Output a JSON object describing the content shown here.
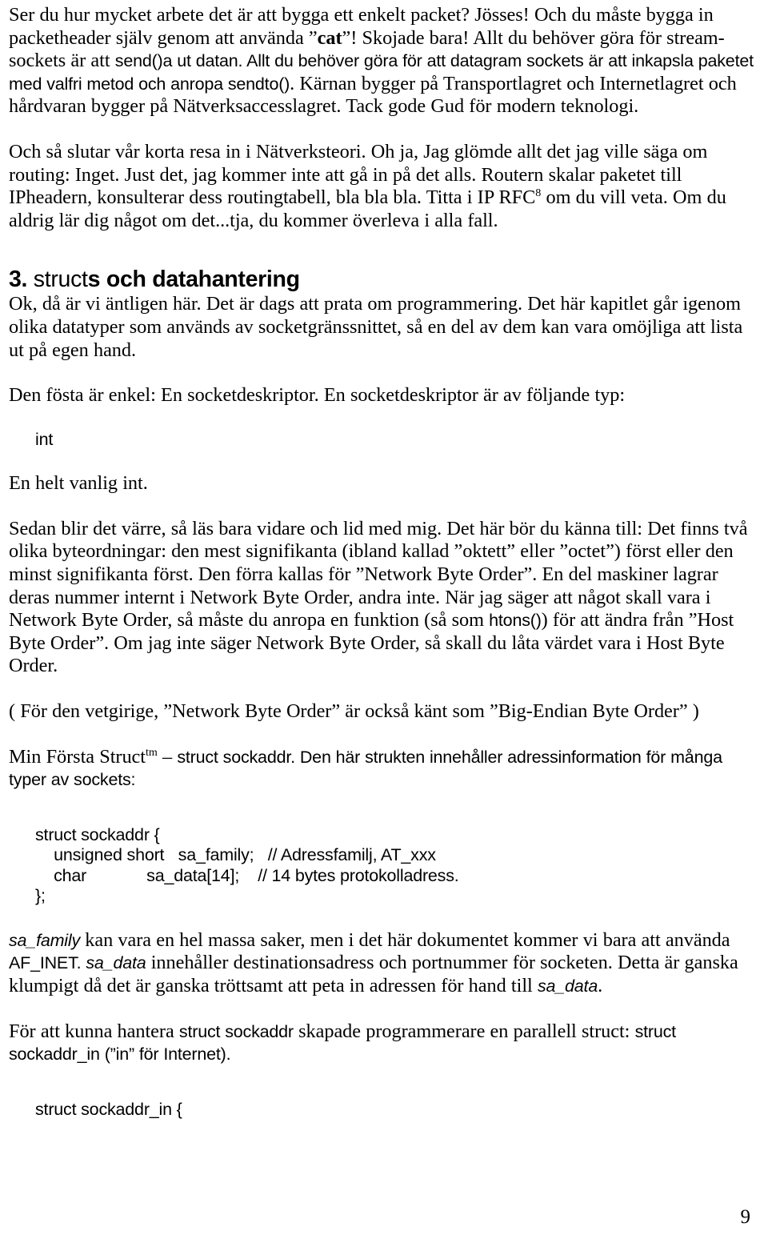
{
  "document": {
    "page_number": "9",
    "language": "sv",
    "paragraphs": {
      "intro_p1_a": "Ser du hur mycket arbete det är att bygga ett enkelt packet? Jösses! Och du måste bygga in packetheader själv genom att använda ”",
      "intro_p1_cat": "cat",
      "intro_p1_b": "”! Skojade bara! Allt du behöver göra för stream-sockets är att ",
      "intro_p1_send": "send()",
      "intro_p1_c": "a ut datan. Allt du behöver göra för att datagram sockets är att inkapsla paketet med valfri metod och anropa ",
      "intro_p1_sendto": "sendto()",
      "intro_p1_d": ". Kärnan bygger på Transportlagret och Internetlagret och hårdvaran bygger på Nätverksaccesslagret. Tack gode Gud för modern teknologi.",
      "intro_p2_a": "Och så slutar vår korta resa in i Nätverksteori. Oh ja, Jag glömde allt det jag ville säga om routing: Inget. Just det, jag kommer inte att gå in på det alls. Routern skalar paketet till IPheadern, konsulterar dess routingtabell, bla bla bla. Titta i IP RFC",
      "intro_p2_sup": "8",
      "intro_p2_b": " om du vill veta. Om du aldrig lär dig något om det...tja, du kommer överleva i alla fall.",
      "heading_num": "3.",
      "heading_code": " struct",
      "heading_rest": "s och datahantering",
      "sec_p1": "Ok, då är vi äntligen här. Det är dags att prata om programmering. Det här kapitlet går igenom olika datatyper som används av socketgränssnittet, så en del av dem kan vara omöjliga att lista ut på egen hand.",
      "sec_p2": "Den fösta är enkel: En socketdeskriptor. En socketdeskriptor är av följande typ:",
      "code_int": "int",
      "sec_p3": "En helt vanlig int.",
      "sec_p4_a": "Sedan blir det värre, så läs bara vidare och lid med mig. Det här bör du känna till: Det finns två olika byteordningar: den mest signifikanta (ibland kallad ”oktett” eller ”octet”) först eller den minst signifikanta först. Den förra kallas för ”Network Byte Order”. En del maskiner lagrar deras nummer internt i Network Byte Order, andra inte. När jag säger att något skall vara i Network Byte Order, så måste du anropa en funktion (så som ",
      "sec_p4_htons": "htons()",
      "sec_p4_b": ") för att ändra från ”Host Byte Order”. Om jag inte säger Network Byte Order, så skall du låta värdet vara i Host Byte Order.",
      "sec_p5": "( För den vetgirige, ”Network Byte Order” är också känt som ”Big-Endian Byte Order” )",
      "sec_p6_a": "Min Första Struct",
      "sec_p6_sup": "tm",
      "sec_p6_b": " – ",
      "sec_p6_code": "struct sockaddr",
      "sec_p6_c": ". Den här strukten innehåller adressinformation för många typer av sockets:",
      "code_sockaddr": "struct sockaddr {\n    unsigned short   sa_family;   // Adressfamilj, AT_xxx\n    char             sa_data[14];    // 14 bytes protokolladress.\n};",
      "sec_p7_sa_family": "sa_family",
      "sec_p7_a": " kan vara en hel massa saker, men i det här dokumentet kommer vi bara att använda ",
      "sec_p7_afinet": "AF_INET",
      "sec_p7_b": ". ",
      "sec_p7_sa_data": "sa_data",
      "sec_p7_c": " innehåller destinationsadress och portnummer för socketen. Detta är ganska klumpigt då det är ganska tröttsamt att peta in adressen för hand till ",
      "sec_p7_sa_data2": "sa_data",
      "sec_p7_d": ".",
      "sec_p8_a": "För att kunna hantera ",
      "sec_p8_code1": "struct sockaddr",
      "sec_p8_b": " skapade programmerare en parallell struct: ",
      "sec_p8_code2": "struct sockaddr_in",
      "sec_p8_c": " (”in” för Internet).",
      "code_sockaddr_in": "struct sockaddr_in {"
    }
  }
}
